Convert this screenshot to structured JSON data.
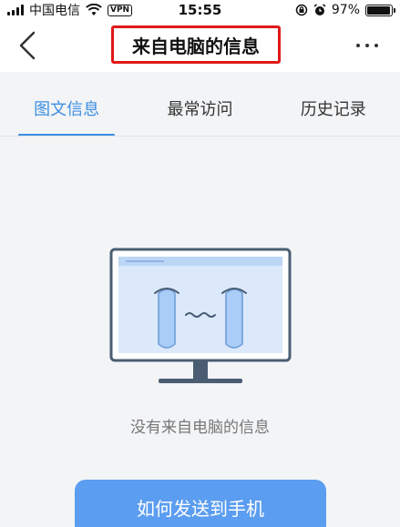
{
  "status_bar": {
    "carrier": "中国电信",
    "vpn": "VPN",
    "time": "15:55",
    "battery": "97%",
    "battery_level": 0.97
  },
  "header": {
    "title": "来自电脑的信息"
  },
  "tabs": [
    {
      "label": "图文信息",
      "active": true
    },
    {
      "label": "最常访问",
      "active": false
    },
    {
      "label": "历史记录",
      "active": false
    }
  ],
  "empty_state": {
    "message": "没有来自电脑的信息",
    "button_label": "如何发送到手机"
  },
  "colors": {
    "accent": "#3d8fe3",
    "button": "#5b9df0",
    "highlight_border": "#e01818"
  }
}
